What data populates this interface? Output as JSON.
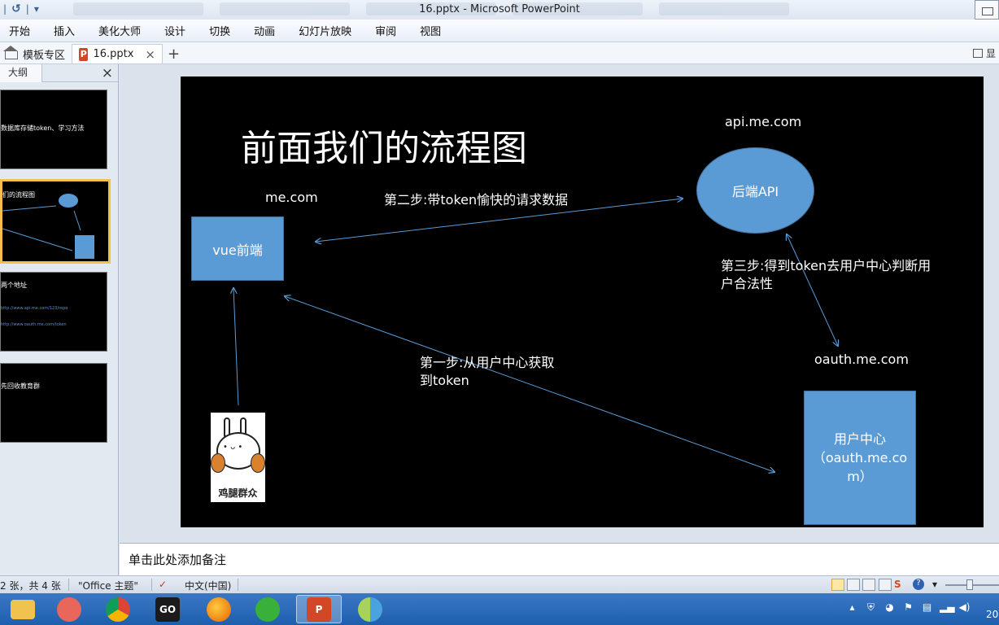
{
  "window": {
    "title": "16.pptx - Microsoft PowerPoint"
  },
  "menu": [
    "开始",
    "插入",
    "美化大师",
    "设计",
    "切换",
    "动画",
    "幻灯片放映",
    "审阅",
    "视图"
  ],
  "tabs": {
    "template_tab": "模板专区",
    "doc_tab": "16.pptx",
    "ppt_icon_letter": "P",
    "add": "+",
    "close": "×",
    "right_label": "显"
  },
  "outline": {
    "tab_label": "大纲",
    "close": "×",
    "thumbs": [
      {
        "text": "数据库存储token、学习方法"
      },
      {
        "text": "们的流程图",
        "line": "第二步:带token愉快的请求数据",
        "ellipse": "后端API"
      },
      {
        "text": "两个地址",
        "link1": "http://www.api.me.com/123/repo",
        "link2": "http://www.oauth.me.com/token"
      },
      {
        "text": "先回收教育群"
      }
    ]
  },
  "slide": {
    "title": "前面我们的流程图",
    "api_domain": "api.me.com",
    "backend_label": "后端API",
    "me_domain": "me.com",
    "frontend_label": "vue前端",
    "step2": "第二步:带token愉快的请求数据",
    "step3_line1": "第三步:得到token去用户中心判断用",
    "step3_line2": "户合法性",
    "oauth_domain": "oauth.me.com",
    "step1_line1": "第一步:从用户中心获取",
    "step1_line2": "到token",
    "user_center_line1": "用户中心",
    "user_center_line2": "（oauth.me.co",
    "user_center_line3": "m）",
    "sticker_caption": "鸡腿群众",
    "sticker_face": "• ᴗ •"
  },
  "notes": {
    "placeholder": "单击此处添加备注"
  },
  "status": {
    "slide_info": "2 张，共 4 张",
    "theme": "\"Office 主题\"",
    "language": "中文(中国)"
  },
  "taskbar": {
    "apps": [
      "file-explorer",
      "avatar-app",
      "chrome",
      "goland",
      "firefox",
      "wechat",
      "powerpoint",
      "other-app"
    ],
    "clock": "20"
  },
  "colors": {
    "shape_blue": "#5b9bd5",
    "slide_bg": "#000000",
    "taskbar": "#2a6bbb",
    "selected_thumb": "#f4c14a"
  }
}
